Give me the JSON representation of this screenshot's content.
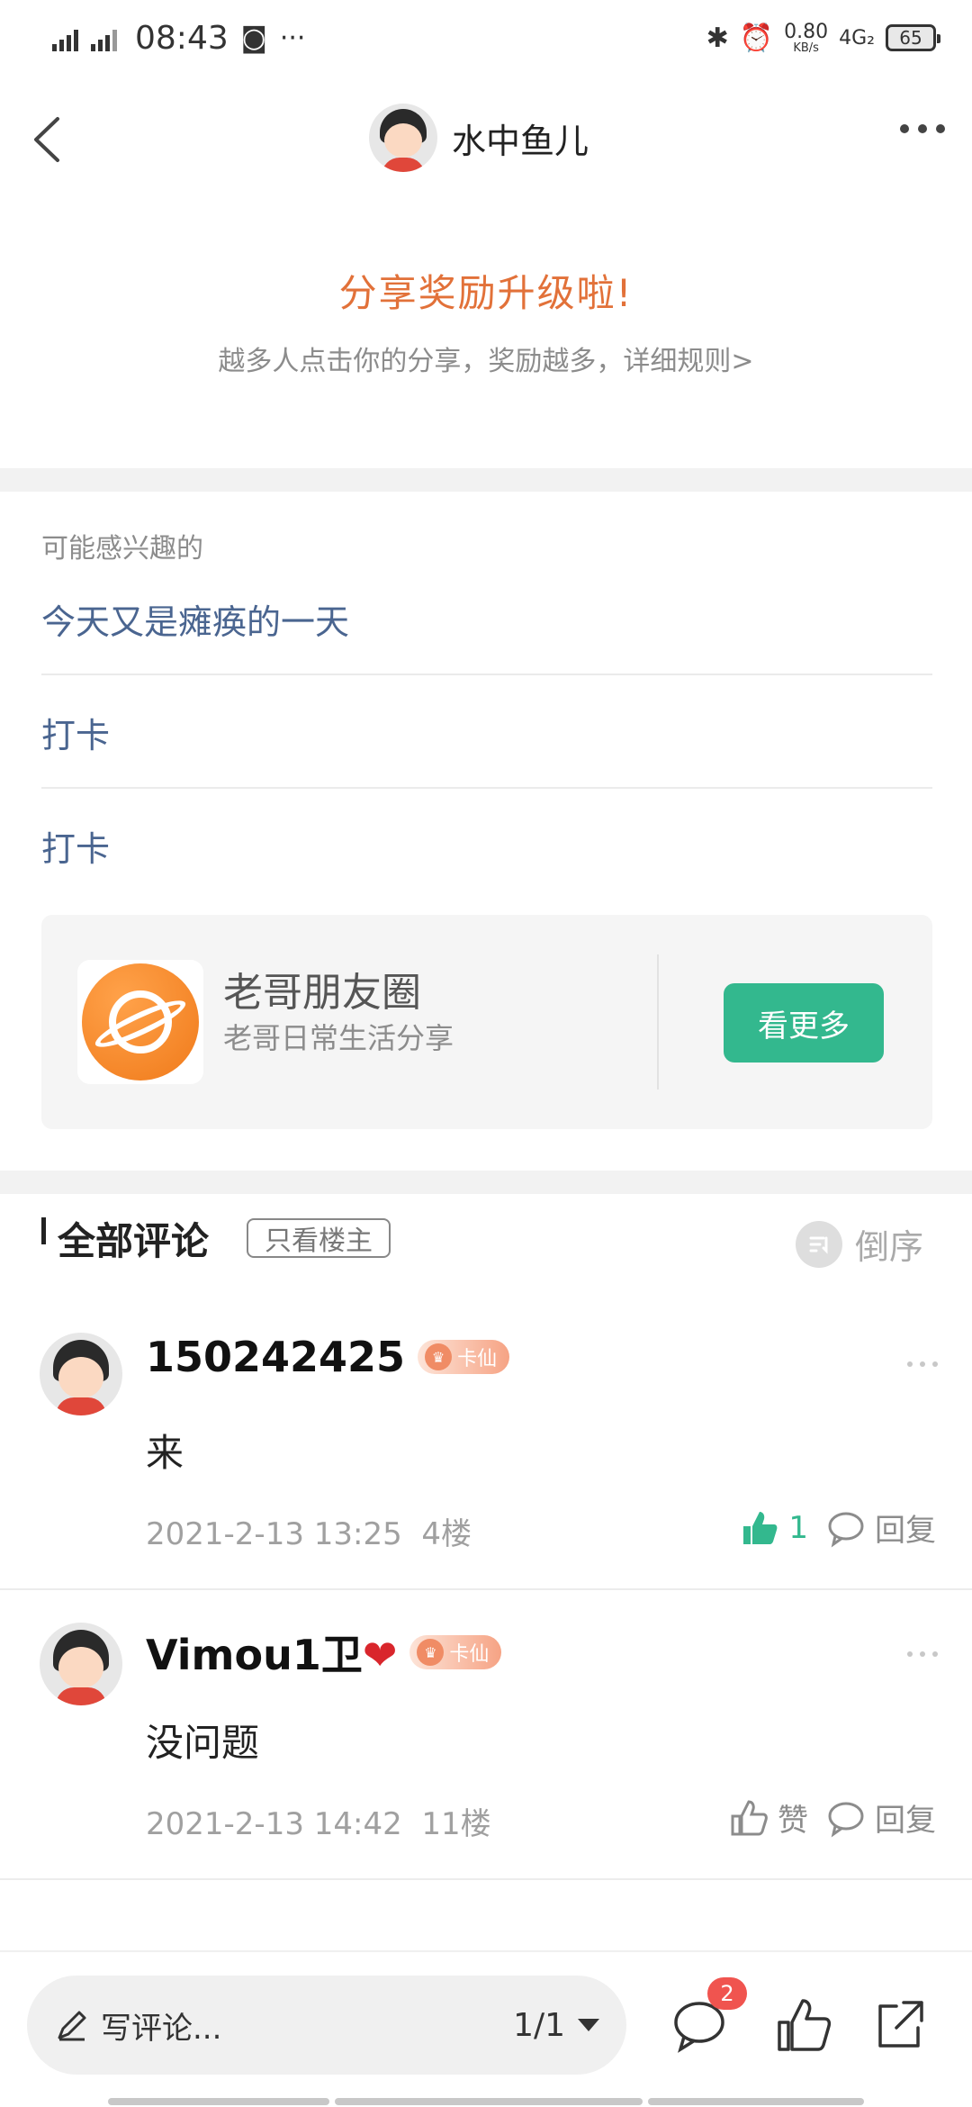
{
  "status_bar": {
    "signal_1": "4G",
    "signal_2": "4GHD",
    "time": "08:43",
    "speed_value": "0.80",
    "speed_unit": "KB/s",
    "network": "4G₂",
    "battery": "65"
  },
  "header": {
    "title": "水中鱼儿"
  },
  "reward": {
    "title": "分享奖励升级啦!",
    "subtitle": "越多人点击你的分享，奖励越多，详细规则>"
  },
  "interest": {
    "label": "可能感兴趣的",
    "items": [
      "今天又是瘫痪的一天",
      "打卡",
      "打卡"
    ]
  },
  "circle": {
    "name": "老哥朋友圈",
    "desc": "老哥日常生活分享",
    "button": "看更多"
  },
  "comments_header": {
    "title": "全部评论",
    "only_owner": "只看楼主",
    "sort": "倒序"
  },
  "comments": [
    {
      "user": "150242425",
      "badge": "卡仙",
      "text": "来",
      "time": "2021-2-13 13:25",
      "floor": "4楼",
      "like_label": "1",
      "reply_label": "回复"
    },
    {
      "user": "Vimou1卫",
      "heart": "❤",
      "badge": "卡仙",
      "text": "没问题",
      "time": "2021-2-13 14:42",
      "floor": "11楼",
      "like_label": "赞",
      "reply_label": "回复"
    }
  ],
  "bottom_bar": {
    "write_label": "写评论...",
    "page": "1/1",
    "comment_count": "2"
  },
  "colors": {
    "accent_green": "#33b88e",
    "reward_orange": "#e27139",
    "link_blue": "#4a6590",
    "badge_red": "#f0544f"
  }
}
